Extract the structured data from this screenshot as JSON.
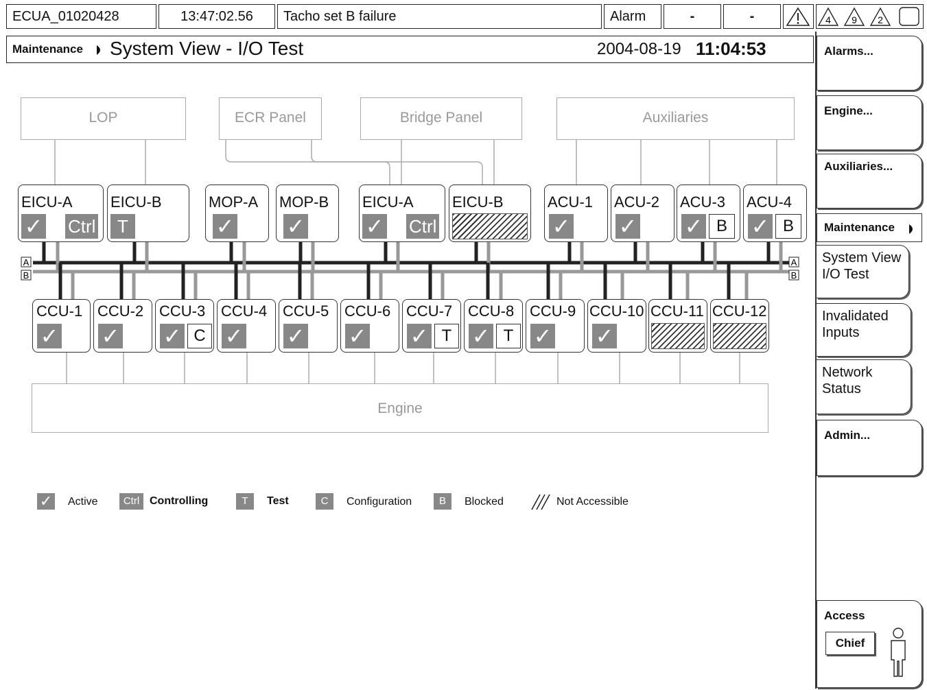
{
  "status_bar": {
    "unit_id": "ECUA_01020428",
    "time": "13:47:02.56",
    "message": "Tacho set B failure",
    "alarm_label": "Alarm",
    "field1": "-",
    "field2": "-",
    "counters": [
      "4",
      "9",
      "2"
    ]
  },
  "header": {
    "breadcrumb": "Maintenance",
    "title": "System View - I/O Test",
    "date": "2004-08-19",
    "time": "11:04:53"
  },
  "menu": {
    "alarms": "Alarms...",
    "engine": "Engine...",
    "auxiliaries": "Auxiliaries...",
    "maintenance": "Maintenance",
    "sub": {
      "system_view": "System View I/O Test",
      "invalidated_inputs": "Invalidated Inputs",
      "network_status": "Network Status"
    },
    "admin": "Admin...",
    "access_label": "Access",
    "access_level": "Chief"
  },
  "panels": {
    "lop": "LOP",
    "ecr": "ECR Panel",
    "bridge": "Bridge Panel",
    "auxiliaries": "Auxiliaries",
    "engine": "Engine"
  },
  "bus_labels": {
    "a": "A",
    "b": "B"
  },
  "upper_units": [
    {
      "name": "EICU-A",
      "state": "Active + Controlling",
      "tag": "Ctrl"
    },
    {
      "name": "EICU-B",
      "state": "Test",
      "tag": "T"
    },
    {
      "name": "MOP-A",
      "state": "Active"
    },
    {
      "name": "MOP-B",
      "state": "Active"
    },
    {
      "name": "EICU-A",
      "state": "Active + Controlling",
      "tag": "Ctrl"
    },
    {
      "name": "EICU-B",
      "state": "Not Accessible"
    },
    {
      "name": "ACU-1",
      "state": "Active"
    },
    {
      "name": "ACU-2",
      "state": "Active"
    },
    {
      "name": "ACU-3",
      "state": "Active + Blocked",
      "tag": "B"
    },
    {
      "name": "ACU-4",
      "state": "Active + Blocked",
      "tag": "B"
    }
  ],
  "ccus": [
    {
      "name": "CCU-1",
      "state": "Active"
    },
    {
      "name": "CCU-2",
      "state": "Active"
    },
    {
      "name": "CCU-3",
      "state": "Active + Configuration",
      "tag": "C"
    },
    {
      "name": "CCU-4",
      "state": "Active"
    },
    {
      "name": "CCU-5",
      "state": "Active"
    },
    {
      "name": "CCU-6",
      "state": "Active"
    },
    {
      "name": "CCU-7",
      "state": "Active + Test",
      "tag": "T"
    },
    {
      "name": "CCU-8",
      "state": "Active + Test",
      "tag": "T"
    },
    {
      "name": "CCU-9",
      "state": "Active"
    },
    {
      "name": "CCU-10",
      "state": "Active"
    },
    {
      "name": "CCU-11",
      "state": "Not Accessible"
    },
    {
      "name": "CCU-12",
      "state": "Not Accessible"
    }
  ],
  "legend": {
    "active": "Active",
    "ctrl_tag": "Ctrl",
    "controlling": "Controlling",
    "t_tag": "T",
    "test": "Test",
    "c_tag": "C",
    "configuration": "Configuration",
    "b_tag": "B",
    "blocked": "Blocked",
    "not_accessible": "Not Accessible"
  },
  "glyphs": {
    "check": "✓"
  },
  "colors": {
    "state_fill": "#888888",
    "bus_a": "#222222",
    "bus_b": "#999999"
  }
}
